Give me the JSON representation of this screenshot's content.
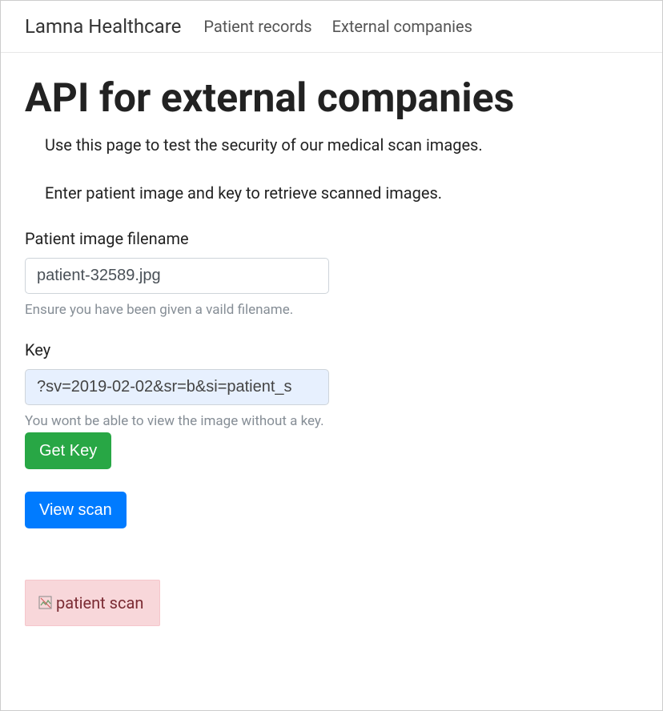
{
  "nav": {
    "brand": "Lamna Healthcare",
    "links": {
      "patient_records": "Patient records",
      "external_companies": "External companies"
    }
  },
  "page": {
    "title": "API for external companies",
    "intro1": "Use this page to test the security of our medical scan images.",
    "intro2": "Enter patient image and key to retrieve scanned images."
  },
  "fields": {
    "filename": {
      "label": "Patient image filename",
      "value": "patient-32589.jpg",
      "help": "Ensure you have been given a vaild filename."
    },
    "key": {
      "label": "Key",
      "value": "?sv=2019-02-02&sr=b&si=patient_s",
      "help": "You wont be able to view the image without a key."
    }
  },
  "buttons": {
    "get_key": "Get Key",
    "view_scan": "View scan"
  },
  "image": {
    "alt_text": "patient scan"
  }
}
